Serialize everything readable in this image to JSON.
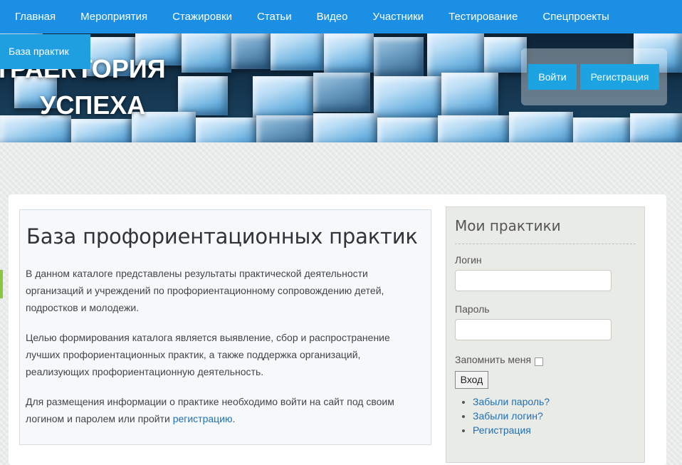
{
  "nav": {
    "items": [
      "Главная",
      "Мероприятия",
      "Стажировки",
      "Статьи",
      "Видео",
      "Участники",
      "Тестирование",
      "Спецпроекты"
    ]
  },
  "banner": {
    "base_tab": "База практик",
    "logo_line1": "ТРАЕКТОРИЯ",
    "logo_line2": "УСПЕХА",
    "login_button": "Войти",
    "register_button": "Регистрация"
  },
  "content": {
    "title": "База профориентационных практик",
    "p1": "В данном каталоге представлены результаты практической деятельности организаций и учреждений по профориентационному сопровождению детей, подростков и молодежи.",
    "p2": "Целью формирования каталога является выявление, сбор и распространение лучших профориентационных практик, а также поддержка организаций, реализующих профориентационную деятельность.",
    "p3_text": "Для размещения информации о практике необходимо войти на сайт под своим логином и паролем или пройти ",
    "p3_link": "регистрацию",
    "p3_end": "."
  },
  "sidebar": {
    "title": "Мои практики",
    "login_label": "Логин",
    "password_label": "Пароль",
    "remember_label": "Запомнить меня",
    "submit": "Вход",
    "links": [
      "Забыли пароль?",
      "Забыли логин?",
      "Регистрация"
    ]
  },
  "colors": {
    "nav_bg": "#1a8fe3",
    "button_blue": "#1da2e2",
    "link": "#1f6fb2"
  }
}
